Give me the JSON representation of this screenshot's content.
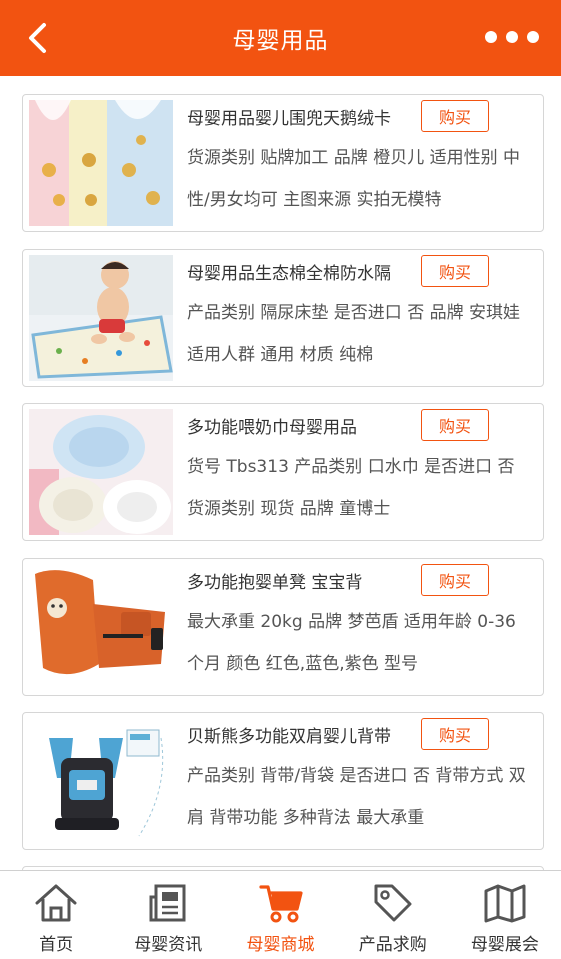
{
  "header": {
    "title": "母婴用品"
  },
  "products": [
    {
      "name": "母婴用品婴儿围兜天鹅绒卡",
      "buy_label": "购买",
      "desc": "货源类别 贴牌加工 品牌 橙贝儿 适用性别 中性/男女均可 主图来源 实拍无模特"
    },
    {
      "name": "母婴用品生态棉全棉防水隔",
      "buy_label": "购买",
      "desc": "产品类别 隔尿床垫 是否进口 否 品牌 安琪娃 适用人群 通用 材质 纯棉"
    },
    {
      "name": "多功能喂奶巾母婴用品",
      "buy_label": "购买",
      "desc": "货号 Tbs313 产品类别 口水巾 是否进口 否 货源类别 现货 品牌 童博士"
    },
    {
      "name": "多功能抱婴单凳 宝宝背",
      "buy_label": "购买",
      "desc": "最大承重 20kg 品牌 梦芭盾 适用年龄 0-36个月 颜色 红色,蓝色,紫色 型号"
    },
    {
      "name": "贝斯熊多功能双肩婴儿背带",
      "buy_label": "购买",
      "desc": "产品类别 背带/背袋 是否进口 否 背带方式 双肩 背带功能 多种背法 最大承重"
    }
  ],
  "tabs": [
    {
      "label": "首页",
      "icon": "home-icon",
      "active": false
    },
    {
      "label": "母婴资讯",
      "icon": "news-icon",
      "active": false
    },
    {
      "label": "母婴商城",
      "icon": "cart-icon",
      "active": true
    },
    {
      "label": "产品求购",
      "icon": "tag-icon",
      "active": false
    },
    {
      "label": "母婴展会",
      "icon": "map-icon",
      "active": false
    }
  ],
  "colors": {
    "brand": "#f25311",
    "border": "#d6d6d6"
  }
}
